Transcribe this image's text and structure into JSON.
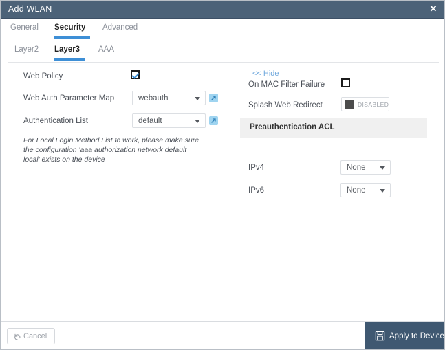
{
  "window": {
    "title": "Add WLAN",
    "close_icon": "close-icon"
  },
  "tabs": {
    "main": [
      {
        "id": "general",
        "label": "General",
        "active": false
      },
      {
        "id": "security",
        "label": "Security",
        "active": true
      },
      {
        "id": "advanced",
        "label": "Advanced",
        "active": false
      }
    ],
    "sub": [
      {
        "id": "layer2",
        "label": "Layer2",
        "active": false
      },
      {
        "id": "layer3",
        "label": "Layer3",
        "active": true
      },
      {
        "id": "aaa",
        "label": "AAA",
        "active": false
      }
    ]
  },
  "left_column": {
    "web_policy": {
      "label": "Web Policy",
      "checked": true
    },
    "web_auth_parameter_map": {
      "label": "Web Auth Parameter Map",
      "value": "webauth",
      "edit_icon": "external-link-icon"
    },
    "authentication_list": {
      "label": "Authentication List",
      "value": "default",
      "edit_icon": "external-link-icon"
    },
    "note": "For Local Login Method List to work, please make sure the configuration 'aaa authorization network default local' exists on the device"
  },
  "right_column": {
    "hide_link": "<< Hide",
    "on_mac_filter_failure": {
      "label": "On MAC Filter Failure",
      "checked": false
    },
    "splash_web_redirect": {
      "label": "Splash Web Redirect",
      "state": "DISABLED"
    },
    "preauth_acl": {
      "header": "Preauthentication ACL",
      "ipv4": {
        "label": "IPv4",
        "value": "None"
      },
      "ipv6": {
        "label": "IPv6",
        "value": "None"
      }
    }
  },
  "footer": {
    "cancel_label": "Cancel",
    "cancel_icon": "undo-icon",
    "apply_label": "Apply to Device",
    "apply_icon": "save-icon"
  },
  "colors": {
    "titlebar": "#4c6278",
    "accent_blue": "#3e8fd6",
    "link_blue": "#6fa8dd",
    "apply_button": "#3f5871",
    "section_header_bg": "#f0f0f0",
    "edit_button": "#9fd4f0"
  }
}
